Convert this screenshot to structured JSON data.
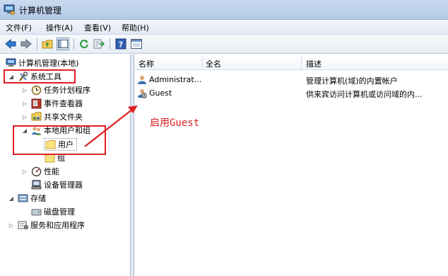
{
  "window": {
    "title": "计算机管理"
  },
  "menu": [
    "文件(F)",
    "操作(A)",
    "查看(V)",
    "帮助(H)"
  ],
  "tree": {
    "root": "计算机管理(本地)",
    "system_tools": "系统工具",
    "task_scheduler": "任务计划程序",
    "event_viewer": "事件查看器",
    "shared_folders": "共享文件夹",
    "local_users_groups": "本地用户和组",
    "users": "用户",
    "groups": "组",
    "performance": "性能",
    "device_manager": "设备管理器",
    "storage": "存储",
    "disk_management": "磁盘管理",
    "services_apps": "服务和应用程序"
  },
  "list": {
    "columns": [
      "名称",
      "全名",
      "描述"
    ],
    "rows": [
      {
        "name": "Administrat...",
        "fullname": "",
        "description": "管理计算机(域)的内置帐户"
      },
      {
        "name": "Guest",
        "fullname": "",
        "description": "供来宾访问计算机或访问域的内..."
      }
    ]
  },
  "annotation": {
    "text": "启用Guest",
    "color": "#d41f1f"
  }
}
